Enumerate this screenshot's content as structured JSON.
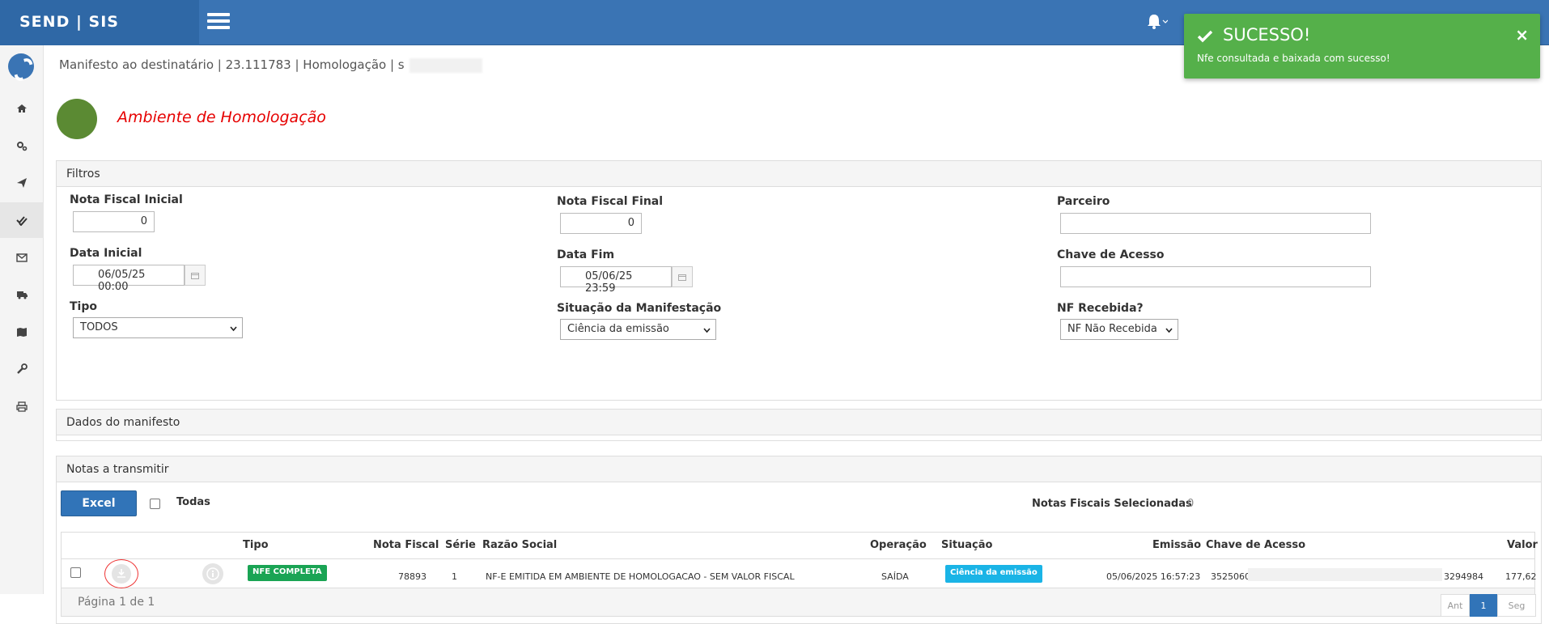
{
  "header": {
    "brand": "SEND | SIS"
  },
  "breadcrumb": "Manifesto ao destinatário | 23.111783 | Homologação | s",
  "environment": "Ambiente de Homologação",
  "filtros": {
    "title": "Filtros",
    "nf_inicial_label": "Nota Fiscal Inicial",
    "nf_inicial_value": "0",
    "nf_final_label": "Nota Fiscal Final",
    "nf_final_value": "0",
    "parceiro_label": "Parceiro",
    "parceiro_value": "",
    "data_inicial_label": "Data Inicial",
    "data_inicial_value": "06/05/25 00:00",
    "data_fim_label": "Data Fim",
    "data_fim_value": "05/06/25 23:59",
    "chave_label": "Chave de Acesso",
    "chave_value": "",
    "tipo_label": "Tipo",
    "tipo_value": "TODOS",
    "situacao_label": "Situação da Manifestação",
    "situacao_value": "Ciência da emissão",
    "nf_recebida_label": "NF Recebida?",
    "nf_recebida_value": "NF Não Recebida"
  },
  "dados": {
    "title": "Dados do manifesto"
  },
  "notas": {
    "title": "Notas a transmitir",
    "excel_label": "Excel",
    "todas_label": "Todas",
    "selecionadas_label": "Notas Fiscais Selecionadas",
    "selecionadas_count": "0",
    "columns": {
      "tipo": "Tipo",
      "nota_fiscal": "Nota Fiscal",
      "serie": "Série",
      "razao": "Razão Social",
      "operacao": "Operação",
      "situacao": "Situação",
      "emissao": "Emissão",
      "chave": "Chave de Acesso",
      "valor": "Valor"
    },
    "row": {
      "tipo": "NFE COMPLETA",
      "nota_fiscal": "78893",
      "serie": "1",
      "razao": "NF-E EMITIDA EM AMBIENTE DE HOMOLOGACAO - SEM VALOR FISCAL",
      "operacao": "SAÍDA",
      "situacao": "Ciência da emissão",
      "emissao": "05/06/2025 16:57:23",
      "chave_start": "3525060",
      "chave_end": "3294984",
      "valor": "177,62"
    },
    "pagina": "Página 1 de 1",
    "pag_prev": "Ant",
    "pag_current": "1",
    "pag_next": "Seg"
  },
  "toast": {
    "title": "SUCESSO!",
    "message": "Nfe consultada e baixada com sucesso!",
    "close": "×"
  },
  "colors": {
    "topbar": "#3a74b4",
    "success": "#55b04a",
    "env_red": "#e60000",
    "badge_green": "#1aa454",
    "badge_blue": "#1ab4e6"
  }
}
